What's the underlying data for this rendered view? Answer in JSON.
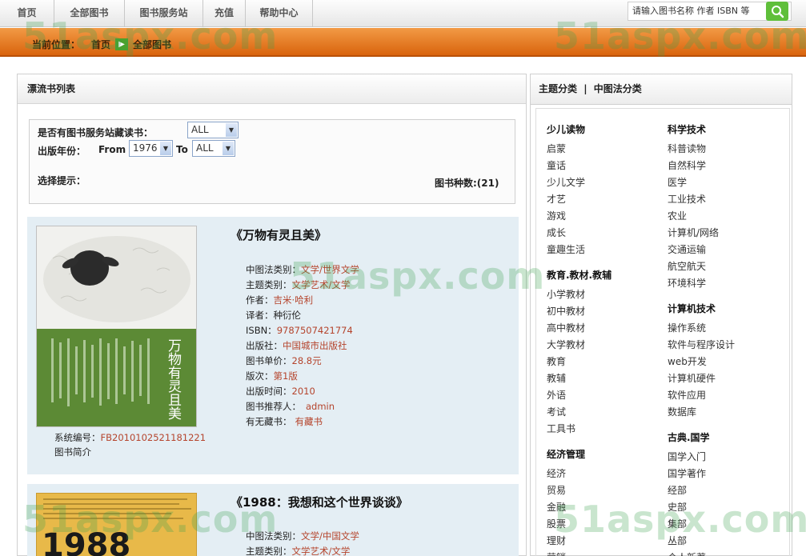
{
  "nav": {
    "items": [
      "首页",
      "全部图书",
      "图书服务站",
      "充值",
      "帮助中心"
    ],
    "search_placeholder": "请输入图书名称 作者 ISBN 等"
  },
  "breadcrumb": {
    "label": "当前位置：",
    "home": "首页",
    "current": "全部图书"
  },
  "watermark": "51aspx.com",
  "left": {
    "title": "漂流书列表",
    "filter": {
      "station_label": "是否有图书服务站藏读书：",
      "station_value": "ALL",
      "year_label": "出版年份：",
      "from_label": "From",
      "from_value": "1976",
      "to_label": "To",
      "to_value": "ALL",
      "hint_label": "选择提示：",
      "count_label": "图书种数:(21)"
    },
    "books": [
      {
        "title": "《万物有灵且美》",
        "clc_label": "中图法类别：",
        "clc": "文学/世界文学",
        "topic_label": "主题类别：",
        "topic": "文学艺术/文学",
        "author_label": "作者：",
        "author": "吉米·哈利",
        "translator_label": "译者：",
        "translator": "种衍伦",
        "isbn_label": "ISBN：",
        "isbn": "9787507421774",
        "publisher_label": "出版社：",
        "publisher": "中国城市出版社",
        "price_label": "图书单价：",
        "price": "28.8元",
        "edition_label": "版次：",
        "edition": "第1版",
        "pubdate_label": "出版时间：",
        "pubdate": "2010",
        "recommender_label": "图书推荐人：",
        "recommender": "admin",
        "stock_label": "有无藏书：",
        "stock": "有藏书",
        "sysno_label": "系统编号：",
        "sysno": "FB2010102521181221",
        "intro_label": "图书简介",
        "cover_title": "万物有灵且美"
      },
      {
        "title": "《1988：我想和这个世界谈谈》",
        "clc_label": "中图法类别：",
        "clc": "文学/中国文学",
        "topic_label": "主题类别：",
        "topic": "文学艺术/文学",
        "cover_title": "1988"
      }
    ]
  },
  "right": {
    "tab_topic": "主题分类",
    "separator": "|",
    "tab_clc": "中图法分类",
    "col1": [
      {
        "head": "少儿读物",
        "items": [
          "启蒙",
          "童话",
          "少儿文学",
          "才艺",
          "游戏",
          "成长",
          "童趣生活"
        ]
      },
      {
        "head": "教育.教材.教辅",
        "items": [
          "小学教材",
          "初中教材",
          "高中教材",
          "大学教材",
          "教育",
          "教辅",
          "外语",
          "考试",
          "工具书"
        ]
      },
      {
        "head": "经济管理",
        "items": [
          "经济",
          "贸易",
          "金融",
          "股票",
          "理财",
          "营销"
        ]
      }
    ],
    "col2": [
      {
        "head": "科学技术",
        "items": [
          "科普读物",
          "自然科学",
          "医学",
          "工业技术",
          "农业",
          "计算机/网络",
          "交通运输",
          "航空航天",
          "环境科学"
        ]
      },
      {
        "head": "计算机技术",
        "items": [
          "操作系统",
          "软件与程序设计",
          "web开发",
          "计算机硬件",
          "软件应用",
          "数据库"
        ]
      },
      {
        "head": "古典.国学",
        "items": [
          "国学入门",
          "国学著作",
          "经部",
          "史部",
          "集部",
          "丛部",
          "个人新著"
        ]
      }
    ]
  },
  "colors": {
    "accent_orange": "#e0701a",
    "link_red": "#b5442c",
    "search_green": "#5fbf3a",
    "book_bg": "#e4eef4",
    "cover_green": "#5c8a35"
  }
}
